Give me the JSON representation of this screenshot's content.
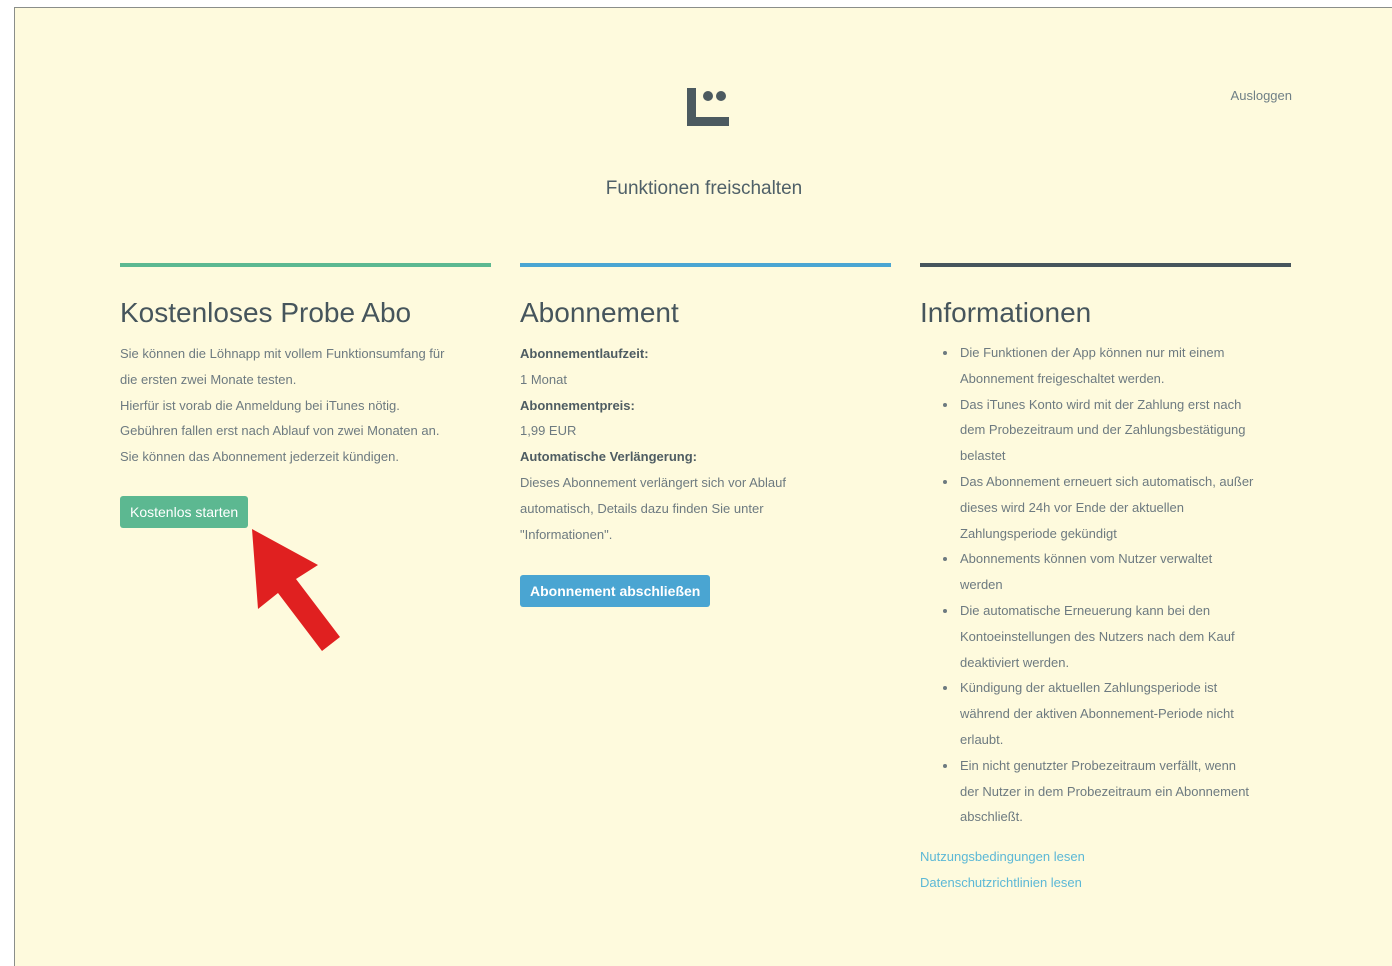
{
  "header": {
    "logout_label": "Ausloggen",
    "title": "Funktionen freischalten"
  },
  "colors": {
    "background": "#fefadd",
    "green": "#5cb891",
    "blue": "#4aa5d2",
    "dark": "#46555c",
    "link": "#5cb8d6",
    "arrow": "#e02020"
  },
  "trial": {
    "title": "Kostenloses Probe Abo",
    "lines": [
      "Sie können die Löhnapp mit vollem Funktionsumfang für",
      "die ersten zwei Monate testen.",
      "Hierfür ist vorab die Anmeldung bei iTunes nötig.",
      "Gebühren fallen erst nach Ablauf von zwei Monaten an.",
      "Sie können das Abonnement jederzeit kündigen."
    ],
    "button_label": "Kostenlos starten"
  },
  "subscription": {
    "title": "Abonnement",
    "duration_label": "Abonnementlaufzeit:",
    "duration_value": "1 Monat",
    "price_label": "Abonnementpreis:",
    "price_value": "1,99 EUR",
    "renewal_label": "Automatische Verlängerung:",
    "renewal_lines": [
      "Dieses Abonnement verlängert sich vor Ablauf",
      "automatisch, Details dazu finden Sie unter",
      "\"Informationen\"."
    ],
    "button_label": "Abonnement abschließen"
  },
  "info": {
    "title": "Informationen",
    "items": [
      [
        "Die Funktionen der App können nur mit einem",
        "Abonnement freigeschaltet werden."
      ],
      [
        "Das iTunes Konto wird mit der Zahlung erst nach",
        "dem Probezeitraum und der Zahlungsbestätigung",
        "belastet"
      ],
      [
        "Das Abonnement erneuert sich automatisch, außer",
        "dieses wird 24h vor Ende der aktuellen",
        "Zahlungsperiode gekündigt"
      ],
      [
        "Abonnements können vom Nutzer verwaltet",
        "werden"
      ],
      [
        "Die automatische Erneuerung kann bei den",
        "Kontoeinstellungen des Nutzers nach dem Kauf",
        "deaktiviert werden."
      ],
      [
        "Kündigung der aktuellen Zahlungsperiode ist",
        "während der aktiven Abonnement-Periode nicht",
        "erlaubt."
      ],
      [
        "Ein nicht genutzter Probezeitraum verfällt, wenn",
        "der Nutzer in dem Probezeitraum ein Abonnement",
        "abschließt."
      ]
    ],
    "terms_link": "Nutzungsbedingungen lesen",
    "privacy_link": "Datenschutzrichtlinien lesen"
  },
  "icons": {
    "logo": "app-logo-icon",
    "arrow": "red-arrow-icon"
  }
}
